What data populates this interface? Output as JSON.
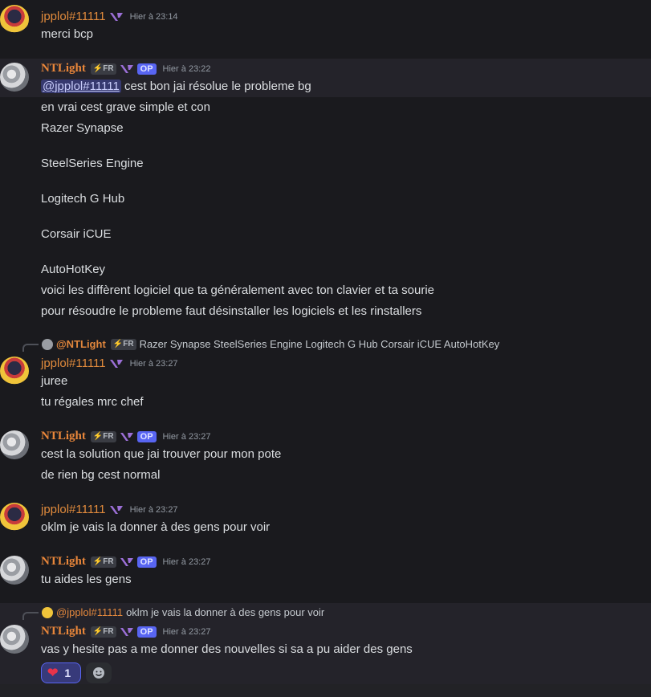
{
  "colors": {
    "background": "#1a1a1e",
    "username_jpplol": "#e08a3c",
    "username_ntlight": "#e8863a",
    "op_badge": "#5865f2",
    "reaction_bg": "#373a7a"
  },
  "users": {
    "jpplol": {
      "name": "jpplol#11111"
    },
    "ntlight": {
      "name": "NTLight",
      "tag": "⚡FR",
      "op": "OP"
    }
  },
  "messages": [
    {
      "author": "jpplol#11111",
      "time": "Hier à 23:14",
      "lines": [
        "merci bcp"
      ]
    },
    {
      "author": "NTLight",
      "tag": "⚡FR",
      "op": "OP",
      "time": "Hier à 23:22",
      "mention": "@jpplol#11111",
      "lines": [
        "cest bon jai résolue le probleme bg",
        "en vrai cest grave simple et con",
        "Razer Synapse",
        "SteelSeries Engine",
        "Logitech G Hub",
        "Corsair iCUE",
        "AutoHotKey",
        "voici les diffèrent logiciel que ta généralement avec ton clavier et ta sourie",
        "pour résoudre le probleme faut désinstaller les logiciels et les rinstallers"
      ]
    },
    {
      "author": "jpplol#11111",
      "time": "Hier à 23:27",
      "reply": {
        "author": "@NTLight",
        "tag": "⚡FR",
        "text": "Razer Synapse  SteelSeries Engine  Logitech G Hub  Corsair iCUE  AutoHotKey"
      },
      "lines": [
        "juree",
        "tu régales mrc chef"
      ]
    },
    {
      "author": "NTLight",
      "tag": "⚡FR",
      "op": "OP",
      "time": "Hier à 23:27",
      "lines": [
        "cest la solution que jai trouver pour mon pote",
        "de rien bg cest normal"
      ]
    },
    {
      "author": "jpplol#11111",
      "time": "Hier à 23:27",
      "lines": [
        "oklm je vais la donner à des gens pour voir"
      ]
    },
    {
      "author": "NTLight",
      "tag": "⚡FR",
      "op": "OP",
      "time": "Hier à 23:27",
      "lines": [
        "tu aides les gens"
      ]
    },
    {
      "author": "NTLight",
      "tag": "⚡FR",
      "op": "OP",
      "time": "Hier à 23:27",
      "reply": {
        "author": "@jpplol#11111",
        "text": "oklm je vais la donner à des gens pour voir"
      },
      "lines": [
        "vas y hesite pas a me donner des nouvelles si sa a pu aider des gens"
      ],
      "reaction": {
        "emoji": "heart",
        "count": "1"
      }
    }
  ]
}
